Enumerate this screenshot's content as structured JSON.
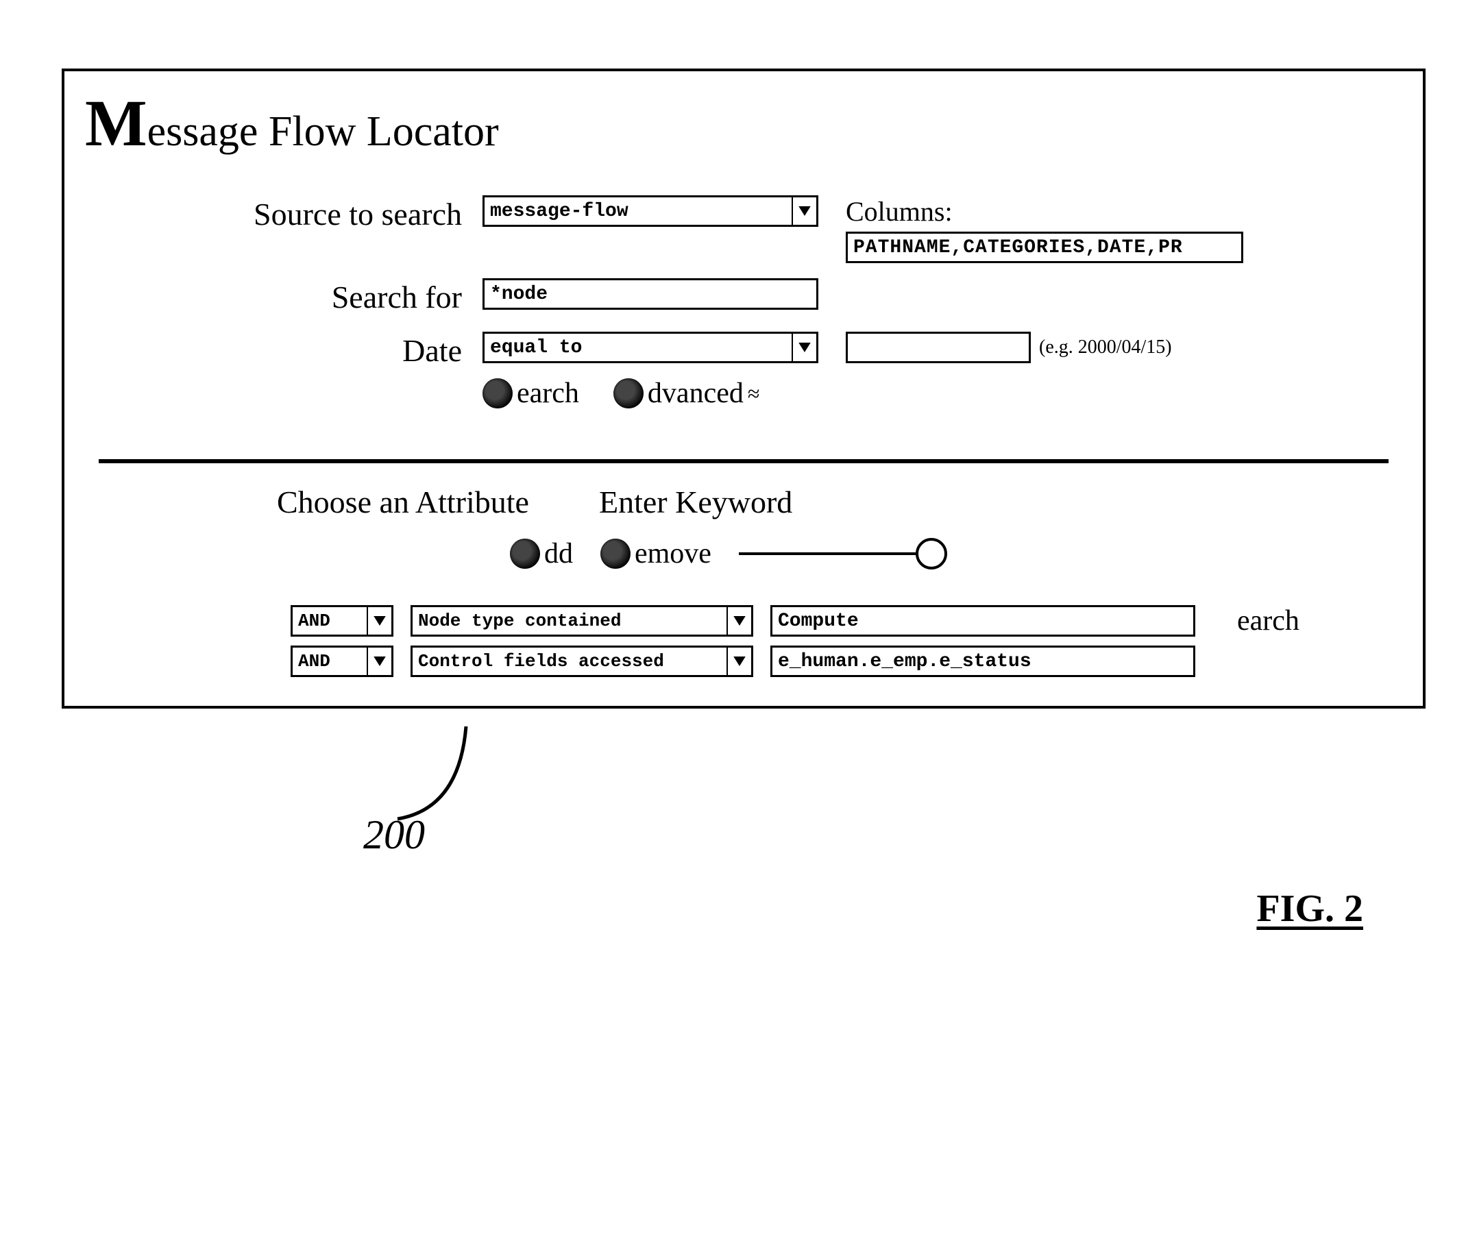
{
  "app_title": "essage Flow Locator",
  "labels": {
    "source_to_search": "Source to search",
    "search_for": "Search for",
    "date": "Date",
    "columns": "Columns:",
    "choose_attribute": "Choose an Attribute",
    "enter_keyword": "Enter Keyword"
  },
  "fields": {
    "source_to_search": "message-flow",
    "columns": "PATHNAME,CATEGORIES,DATE,PR",
    "search_for": "*node",
    "date_op": "equal to",
    "date_value": "",
    "date_hint": "(e.g. 2000/04/15)"
  },
  "buttons": {
    "search": "earch",
    "advanced": "dvanced",
    "add": "dd",
    "remove": "emove"
  },
  "adv_rows": [
    {
      "op": "AND",
      "attribute": "Node type contained",
      "value": "Compute"
    },
    {
      "op": "AND",
      "attribute": "Control fields accessed",
      "value": "e_human.e_emp.e_status"
    }
  ],
  "callout_number": "200",
  "figure_label": "FIG. 2"
}
